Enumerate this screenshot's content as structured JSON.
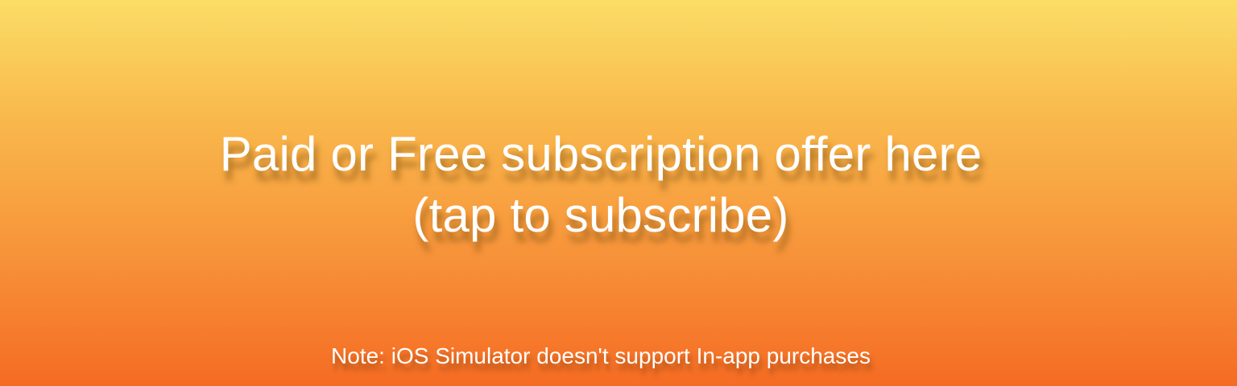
{
  "banner": {
    "offer_line1": "Paid or Free subscription offer here",
    "offer_line2": "(tap to subscribe)",
    "note": "Note: iOS Simulator doesn't support In-app purchases"
  },
  "colors": {
    "gradient_top": "#fbdd66",
    "gradient_bottom": "#f56b23",
    "text": "#ffffff"
  }
}
